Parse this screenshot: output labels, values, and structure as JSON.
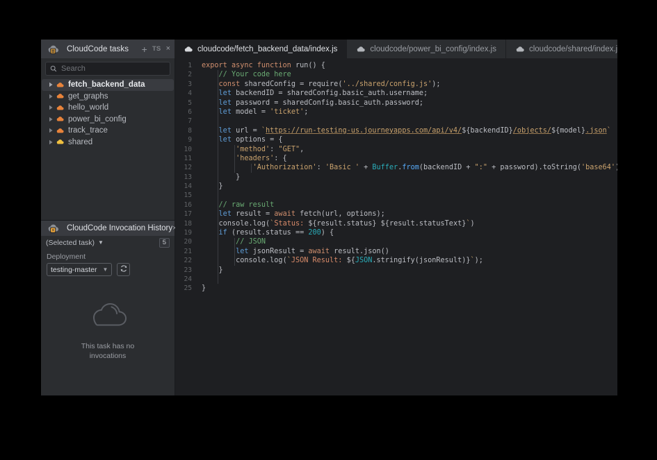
{
  "colors": {
    "window_bg": "#1e1f22",
    "panel_bg": "#2b2d30",
    "tab_active_bg": "#393b40",
    "accent_orange": "#e8833a",
    "accent_yellow": "#f0c040",
    "text_primary": "#dfe1e5",
    "text_muted": "#9a9da3",
    "outer_bg": "#000000"
  },
  "tasks_panel": {
    "icon": "cloud-tasks-icon",
    "title": "CloudCode tasks",
    "add_label": "+",
    "ts_label": "TS",
    "close_label": "×",
    "search": {
      "icon": "search-icon",
      "placeholder": "Search",
      "value": ""
    },
    "tree": [
      {
        "label": "fetch_backend_data",
        "icon": "cloud-icon",
        "icon_color": "#e8833a",
        "selected": true,
        "expander": "chevron-right-icon"
      },
      {
        "label": "get_graphs",
        "icon": "cloud-icon",
        "icon_color": "#e8833a",
        "selected": false,
        "expander": "chevron-right-icon"
      },
      {
        "label": "hello_world",
        "icon": "cloud-icon",
        "icon_color": "#e8833a",
        "selected": false,
        "expander": "chevron-right-icon"
      },
      {
        "label": "power_bi_config",
        "icon": "cloud-icon",
        "icon_color": "#e8833a",
        "selected": false,
        "expander": "chevron-right-icon"
      },
      {
        "label": "track_trace",
        "icon": "cloud-icon",
        "icon_color": "#e8833a",
        "selected": false,
        "expander": "chevron-right-icon"
      },
      {
        "label": "shared",
        "icon": "cloud-icon",
        "icon_color": "#f0c040",
        "selected": false,
        "expander": "chevron-right-icon"
      }
    ]
  },
  "invocation_panel": {
    "icon": "cloud-bolt-icon",
    "title": "CloudCode Invocation History",
    "close_label": "×",
    "task_selector": {
      "label": "(Selected task)",
      "caret": "chevron-down-icon",
      "count_badge": "5"
    },
    "deployment": {
      "label": "Deployment",
      "value": "testing-master",
      "caret": "chevron-down-icon",
      "refresh_icon": "refresh-icon"
    },
    "empty_state": {
      "icon": "cloud-outline-icon",
      "line1": "This task has no",
      "line2": "invocations"
    }
  },
  "editor_tabs": [
    {
      "label": "cloudcode/fetch_backend_data/index.js",
      "icon": "cloud-icon",
      "active": true,
      "clipped": false
    },
    {
      "label": "cloudcode/power_bi_config/index.js",
      "icon": "cloud-icon",
      "active": false,
      "clipped": false
    },
    {
      "label": "cloudcode/shared/index.js",
      "icon": "cloud-icon",
      "active": false,
      "clipped": false
    },
    {
      "label": "",
      "icon": "cloud-icon",
      "active": false,
      "clipped": true
    }
  ],
  "editor": {
    "language": "javascript",
    "line_count": 25,
    "lines": [
      {
        "n": "1",
        "segments": [
          {
            "t": "export ",
            "c": "kw"
          },
          {
            "t": "async ",
            "c": "kw"
          },
          {
            "t": "function ",
            "c": "kw"
          },
          {
            "t": "run",
            "c": "pl"
          },
          {
            "t": "() {",
            "c": "pl"
          }
        ]
      },
      {
        "n": "2",
        "segments": [
          {
            "t": "    ",
            "c": "pl"
          },
          {
            "t": "// Your code here",
            "c": "cmt"
          }
        ]
      },
      {
        "n": "3",
        "segments": [
          {
            "t": "    ",
            "c": "pl"
          },
          {
            "t": "const ",
            "c": "kw"
          },
          {
            "t": "sharedConfig = ",
            "c": "pl"
          },
          {
            "t": "require",
            "c": "pl"
          },
          {
            "t": "(",
            "c": "pl"
          },
          {
            "t": "'../shared/config.js'",
            "c": "str"
          },
          {
            "t": ");",
            "c": "pl"
          }
        ]
      },
      {
        "n": "4",
        "segments": [
          {
            "t": "    ",
            "c": "pl"
          },
          {
            "t": "let ",
            "c": "kw2"
          },
          {
            "t": "backendID = sharedConfig.basic_auth.username;",
            "c": "pl"
          }
        ]
      },
      {
        "n": "5",
        "segments": [
          {
            "t": "    ",
            "c": "pl"
          },
          {
            "t": "let ",
            "c": "kw2"
          },
          {
            "t": "password = sharedConfig.basic_auth.password;",
            "c": "pl"
          }
        ]
      },
      {
        "n": "6",
        "segments": [
          {
            "t": "    ",
            "c": "pl"
          },
          {
            "t": "let ",
            "c": "kw2"
          },
          {
            "t": "model = ",
            "c": "pl"
          },
          {
            "t": "'ticket'",
            "c": "str"
          },
          {
            "t": ";",
            "c": "pl"
          }
        ]
      },
      {
        "n": "7",
        "segments": []
      },
      {
        "n": "8",
        "segments": [
          {
            "t": "    ",
            "c": "pl"
          },
          {
            "t": "let ",
            "c": "kw2"
          },
          {
            "t": "url = ",
            "c": "pl"
          },
          {
            "t": "`",
            "c": "str"
          },
          {
            "t": "https://run-testing-us.journeyapps.com/api/v4/",
            "c": "urlstr"
          },
          {
            "t": "${backendID}",
            "c": "tmpl"
          },
          {
            "t": "/objects/",
            "c": "urlstr"
          },
          {
            "t": "${model}",
            "c": "tmpl"
          },
          {
            "t": ".json",
            "c": "urlstr"
          },
          {
            "t": "`",
            "c": "str"
          }
        ]
      },
      {
        "n": "9",
        "segments": [
          {
            "t": "    ",
            "c": "pl"
          },
          {
            "t": "let ",
            "c": "kw2"
          },
          {
            "t": "options = {",
            "c": "pl"
          }
        ]
      },
      {
        "n": "10",
        "segments": [
          {
            "t": "        ",
            "c": "pl"
          },
          {
            "t": "'method'",
            "c": "str"
          },
          {
            "t": ": ",
            "c": "pl"
          },
          {
            "t": "\"GET\"",
            "c": "str"
          },
          {
            "t": ",",
            "c": "pl"
          }
        ]
      },
      {
        "n": "11",
        "segments": [
          {
            "t": "        ",
            "c": "pl"
          },
          {
            "t": "'headers'",
            "c": "str"
          },
          {
            "t": ": {",
            "c": "pl"
          }
        ]
      },
      {
        "n": "12",
        "segments": [
          {
            "t": "            ",
            "c": "pl"
          },
          {
            "t": "'Authorization'",
            "c": "str"
          },
          {
            "t": ": ",
            "c": "pl"
          },
          {
            "t": "'Basic '",
            "c": "str"
          },
          {
            "t": " + ",
            "c": "pl"
          },
          {
            "t": "Buffer",
            "c": "cls"
          },
          {
            "t": ".",
            "c": "pl"
          },
          {
            "t": "from",
            "c": "fn"
          },
          {
            "t": "(backendID + ",
            "c": "pl"
          },
          {
            "t": "\":\"",
            "c": "str"
          },
          {
            "t": " + password).",
            "c": "pl"
          },
          {
            "t": "toString",
            "c": "pl"
          },
          {
            "t": "(",
            "c": "pl"
          },
          {
            "t": "'base64'",
            "c": "str"
          },
          {
            "t": ")",
            "c": "pl"
          }
        ]
      },
      {
        "n": "13",
        "segments": [
          {
            "t": "        }",
            "c": "pl"
          }
        ]
      },
      {
        "n": "14",
        "segments": [
          {
            "t": "    }",
            "c": "pl"
          }
        ]
      },
      {
        "n": "15",
        "segments": []
      },
      {
        "n": "16",
        "segments": [
          {
            "t": "    ",
            "c": "pl"
          },
          {
            "t": "// raw result",
            "c": "cmt"
          }
        ]
      },
      {
        "n": "17",
        "segments": [
          {
            "t": "    ",
            "c": "pl"
          },
          {
            "t": "let ",
            "c": "kw2"
          },
          {
            "t": "result = ",
            "c": "pl"
          },
          {
            "t": "await ",
            "c": "kw"
          },
          {
            "t": "fetch",
            "c": "pl"
          },
          {
            "t": "(url, options);",
            "c": "pl"
          }
        ]
      },
      {
        "n": "18",
        "segments": [
          {
            "t": "    ",
            "c": "pl"
          },
          {
            "t": "console",
            "c": "pl"
          },
          {
            "t": ".",
            "c": "pl"
          },
          {
            "t": "log",
            "c": "pl"
          },
          {
            "t": "(",
            "c": "pl"
          },
          {
            "t": "`",
            "c": "str"
          },
          {
            "t": "Status: ",
            "c": "str2"
          },
          {
            "t": "${result.status}",
            "c": "tmpl"
          },
          {
            "t": " ",
            "c": "str2"
          },
          {
            "t": "${result.statusText}",
            "c": "tmpl"
          },
          {
            "t": "`",
            "c": "str"
          },
          {
            "t": ")",
            "c": "pl"
          }
        ]
      },
      {
        "n": "19",
        "segments": [
          {
            "t": "    ",
            "c": "pl"
          },
          {
            "t": "if ",
            "c": "kw2"
          },
          {
            "t": "(result.status == ",
            "c": "pl"
          },
          {
            "t": "200",
            "c": "num"
          },
          {
            "t": ") {",
            "c": "pl"
          }
        ]
      },
      {
        "n": "20",
        "segments": [
          {
            "t": "        ",
            "c": "pl"
          },
          {
            "t": "// JSON",
            "c": "cmt"
          }
        ]
      },
      {
        "n": "21",
        "segments": [
          {
            "t": "        ",
            "c": "pl"
          },
          {
            "t": "let ",
            "c": "kw2"
          },
          {
            "t": "jsonResult = ",
            "c": "pl"
          },
          {
            "t": "await ",
            "c": "kw"
          },
          {
            "t": "result.",
            "c": "pl"
          },
          {
            "t": "json",
            "c": "pl"
          },
          {
            "t": "()",
            "c": "pl"
          }
        ]
      },
      {
        "n": "22",
        "segments": [
          {
            "t": "        ",
            "c": "pl"
          },
          {
            "t": "console",
            "c": "pl"
          },
          {
            "t": ".",
            "c": "pl"
          },
          {
            "t": "log",
            "c": "pl"
          },
          {
            "t": "(",
            "c": "pl"
          },
          {
            "t": "`",
            "c": "str"
          },
          {
            "t": "JSON Result: ",
            "c": "str2"
          },
          {
            "t": "${",
            "c": "tmpl"
          },
          {
            "t": "JSON",
            "c": "cls"
          },
          {
            "t": ".stringify(jsonResult)}",
            "c": "tmpl"
          },
          {
            "t": "`",
            "c": "str"
          },
          {
            "t": ");",
            "c": "pl"
          }
        ]
      },
      {
        "n": "23",
        "segments": [
          {
            "t": "    }",
            "c": "pl"
          }
        ]
      },
      {
        "n": "24",
        "segments": []
      },
      {
        "n": "25",
        "segments": [
          {
            "t": "}",
            "c": "pl"
          }
        ]
      }
    ]
  }
}
